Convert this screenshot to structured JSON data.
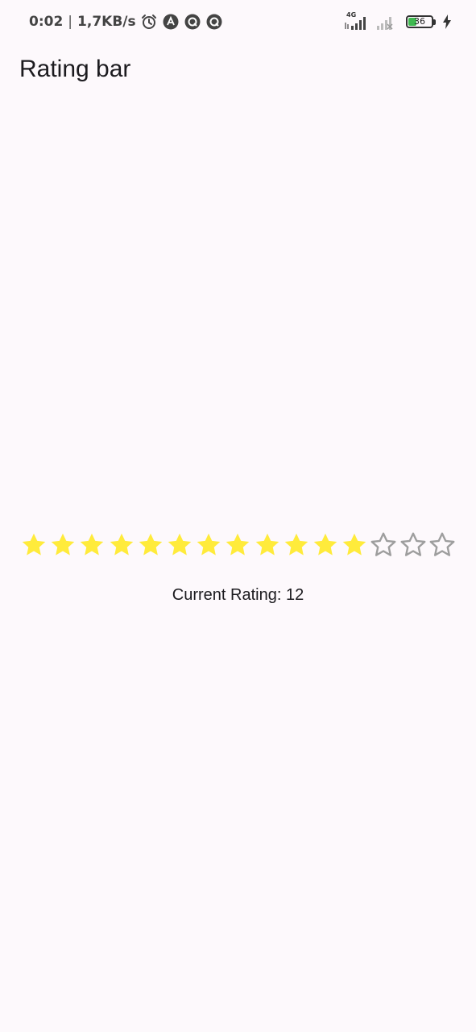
{
  "status_bar": {
    "time": "0:02",
    "separator": "|",
    "speed": "1,7KB/s",
    "network_label": "4G",
    "battery_level": "36",
    "battery_fraction": 0.36,
    "icons": [
      "alarm-icon",
      "app-a-icon",
      "app-q-icon",
      "app-q-icon",
      "signal-icon",
      "signal-off-icon",
      "battery-icon",
      "charging-icon"
    ]
  },
  "app_bar": {
    "title": "Rating bar"
  },
  "rating": {
    "value": 12,
    "max": 15,
    "filled_color": "#ffeb3b",
    "empty_color": "#9e9e9e",
    "label": "Current Rating: 12"
  }
}
